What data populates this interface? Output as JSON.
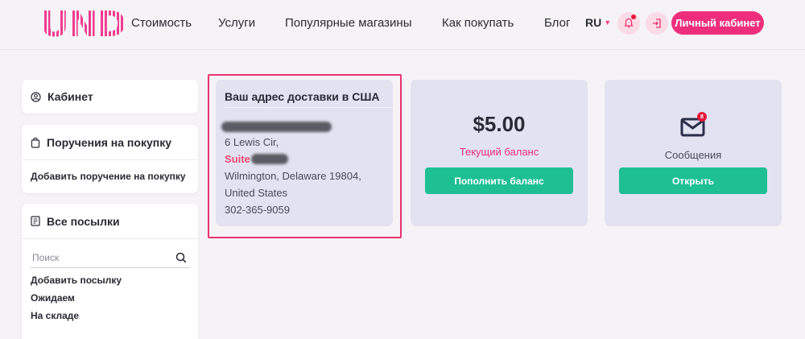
{
  "header": {
    "logo_text": "UND",
    "nav": [
      "Стоимость",
      "Услуги",
      "Популярные магазины",
      "Как покупать",
      "Блог"
    ],
    "language": "RU",
    "cabinet_button": "Личный кабинет"
  },
  "sidebar": {
    "cabinet_title": "Кабинет",
    "orders_title": "Поручения на покупку",
    "add_order_link": "Добавить поручение на покупку",
    "parcels_title": "Все посылки",
    "search_placeholder": "Поиск",
    "links": [
      "Добавить посылку",
      "Ожидаем",
      "На складе"
    ]
  },
  "address_card": {
    "title": "Ваш адрес доставки в США",
    "street": "6 Lewis Cir,",
    "suite_label": "Suite",
    "city_line": "Wilmington, Delaware 19804,",
    "country": "United States",
    "phone": "302-365-9059"
  },
  "balance_card": {
    "amount": "$5.00",
    "label": "Текущий баланс",
    "button": "Пополнить баланс"
  },
  "messages_card": {
    "badge_count": "8",
    "label": "Сообщения",
    "button": "Открыть"
  },
  "colors": {
    "accent_pink": "#ee2e7c",
    "button_green": "#1dbf93",
    "card_bg": "#e3e2f1",
    "badge_red": "#e5183a"
  }
}
